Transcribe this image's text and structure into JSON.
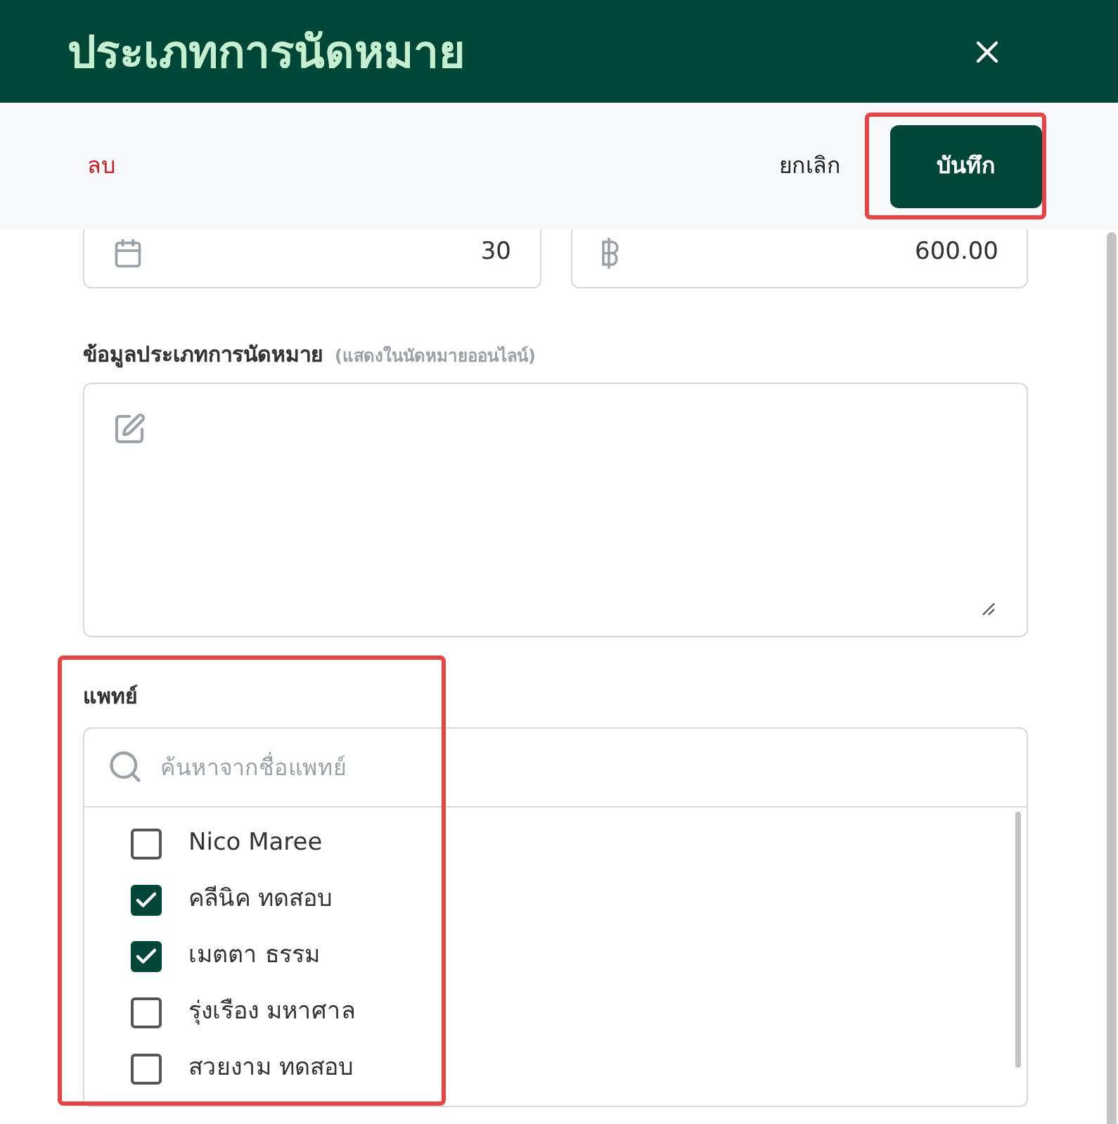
{
  "window": {
    "title": "ประเภทการนัดหมาย"
  },
  "actions": {
    "delete": "ลบ",
    "cancel": "ยกเลิก",
    "save": "บันทึก"
  },
  "duration": {
    "value": "30"
  },
  "price": {
    "value": "600.00"
  },
  "description": {
    "label": "ข้อมูลประเภทการนัดหมาย",
    "hint": "(แสดงในนัดหมายออนไลน์)"
  },
  "doctors": {
    "label": "แพทย์",
    "search": {
      "placeholder": "ค้นหาจากชื่อแพทย์"
    },
    "items": [
      {
        "name": "Nico Maree",
        "checked": false
      },
      {
        "name": "คลีนิค ทดสอบ",
        "checked": true
      },
      {
        "name": "เมตตา ธรรม",
        "checked": true
      },
      {
        "name": "รุ่งเรือง มหาศาล",
        "checked": false
      },
      {
        "name": "สวยงาม ทดสอบ",
        "checked": false
      }
    ]
  }
}
